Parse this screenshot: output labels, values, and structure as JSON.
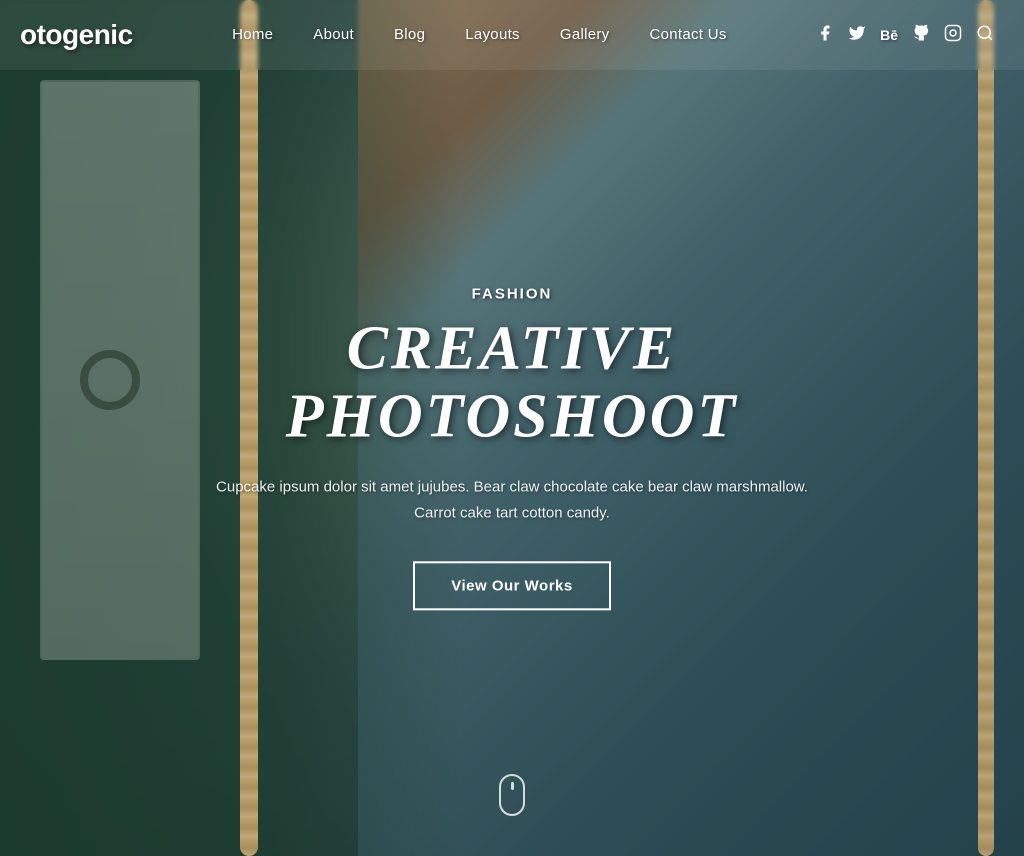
{
  "brand": {
    "logo": "otogenic"
  },
  "nav": {
    "links": [
      {
        "label": "Home",
        "href": "#"
      },
      {
        "label": "About",
        "href": "#"
      },
      {
        "label": "Blog",
        "href": "#"
      },
      {
        "label": "Layouts",
        "href": "#"
      },
      {
        "label": "Gallery",
        "href": "#"
      },
      {
        "label": "Contact Us",
        "href": "#"
      }
    ]
  },
  "social": {
    "icons": [
      {
        "name": "facebook-icon",
        "symbol": "f",
        "label": "Facebook"
      },
      {
        "name": "twitter-icon",
        "symbol": "𝕏",
        "label": "Twitter"
      },
      {
        "name": "behance-icon",
        "symbol": "Bē",
        "label": "Behance"
      },
      {
        "name": "github-icon",
        "symbol": "⌥",
        "label": "GitHub"
      },
      {
        "name": "instagram-icon",
        "symbol": "◎",
        "label": "Instagram"
      },
      {
        "name": "search-icon",
        "symbol": "⌕",
        "label": "Search"
      }
    ]
  },
  "hero": {
    "category": "Fashion",
    "title": "CREATIVE PHOTOSHOOT",
    "description": "Cupcake ipsum dolor sit amet jujubes. Bear claw chocolate cake bear claw\nmarshmallow. Carrot cake tart cotton candy.",
    "cta_label": "View Our Works"
  }
}
